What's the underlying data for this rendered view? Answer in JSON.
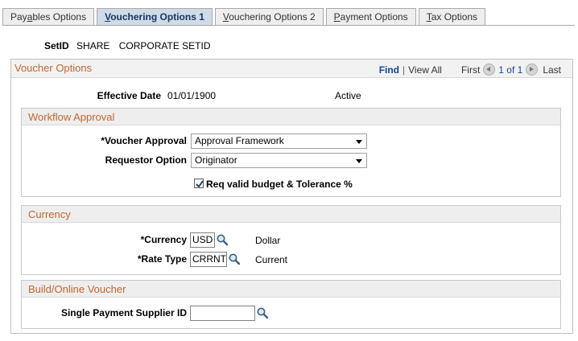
{
  "tabs": [
    {
      "pre": "Pay",
      "u": "a",
      "post": "bles Options"
    },
    {
      "pre": "",
      "u": "V",
      "post": "ouchering Options 1"
    },
    {
      "pre": "",
      "u": "V",
      "post": "ouchering Options 2"
    },
    {
      "pre": "",
      "u": "P",
      "post": "ayment Options"
    },
    {
      "pre": "",
      "u": "T",
      "post": "ax Options"
    }
  ],
  "setid": {
    "label": "SetID",
    "value": "SHARE",
    "description": "CORPORATE SETID"
  },
  "voucher_options": {
    "title": "Voucher Options",
    "nav": {
      "find": "Find",
      "view_all": "View All",
      "first": "First",
      "count": "1 of 1",
      "last": "Last"
    },
    "effective_date": {
      "label": "Effective Date",
      "value": "01/01/1900",
      "status": "Active"
    }
  },
  "workflow": {
    "title": "Workflow Approval",
    "voucher_approval": {
      "label": "*Voucher Approval",
      "value": "Approval Framework"
    },
    "requestor_option": {
      "label": "Requestor Option",
      "value": "Originator"
    },
    "req_budget": {
      "label": "Req valid budget & Tolerance %",
      "checked": true
    }
  },
  "currency": {
    "title": "Currency",
    "currency": {
      "label": "*Currency",
      "value": "USD",
      "description": "Dollar"
    },
    "rate_type": {
      "label": "*Rate Type",
      "value": "CRRNT",
      "description": "Current"
    }
  },
  "build": {
    "title": "Build/Online Voucher",
    "single_payment": {
      "label": "Single Payment Supplier ID",
      "value": ""
    }
  }
}
